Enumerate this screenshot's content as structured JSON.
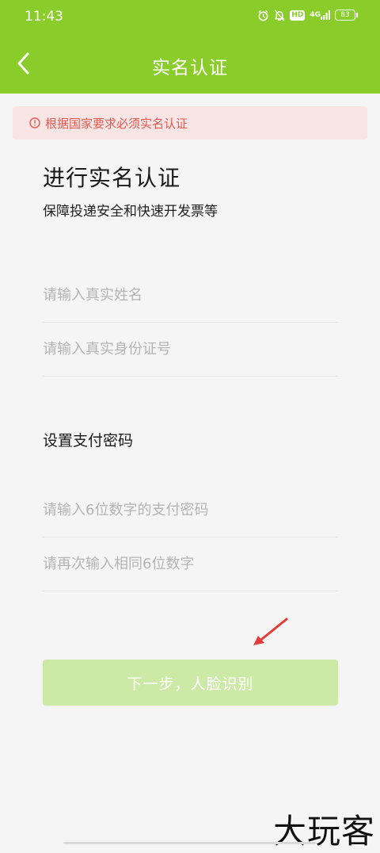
{
  "status_bar": {
    "time": "11:43",
    "hd_badge": "HD",
    "signal": "4G",
    "battery": "83",
    "icons": [
      "alarm-icon",
      "bell-off-icon",
      "hd-icon",
      "signal-icon",
      "battery-icon"
    ]
  },
  "nav": {
    "title": "实名认证",
    "back_icon": "chevron-left-icon"
  },
  "notice": {
    "text": "根据国家要求必须实名认证",
    "icon": "alert-circle-icon",
    "color": "#e05a55",
    "background": "#f9e5e4"
  },
  "intro": {
    "heading": "进行实名认证",
    "subheading": "保障投递安全和快速开发票等"
  },
  "identity_fields": {
    "name_placeholder": "请输入真实姓名",
    "id_placeholder": "请输入真实身份证号"
  },
  "payment": {
    "section_title": "设置支付密码",
    "password_placeholder": "请输入6位数字的支付密码",
    "confirm_placeholder": "请再次输入相同6位数字"
  },
  "actions": {
    "next_label": "下一步，人脸识别"
  },
  "watermark": {
    "text": "大玩客"
  },
  "colors": {
    "brand_green": "#8acd2a",
    "button_disabled": "#cce9a6",
    "annotation_arrow": "#e53a3a"
  }
}
